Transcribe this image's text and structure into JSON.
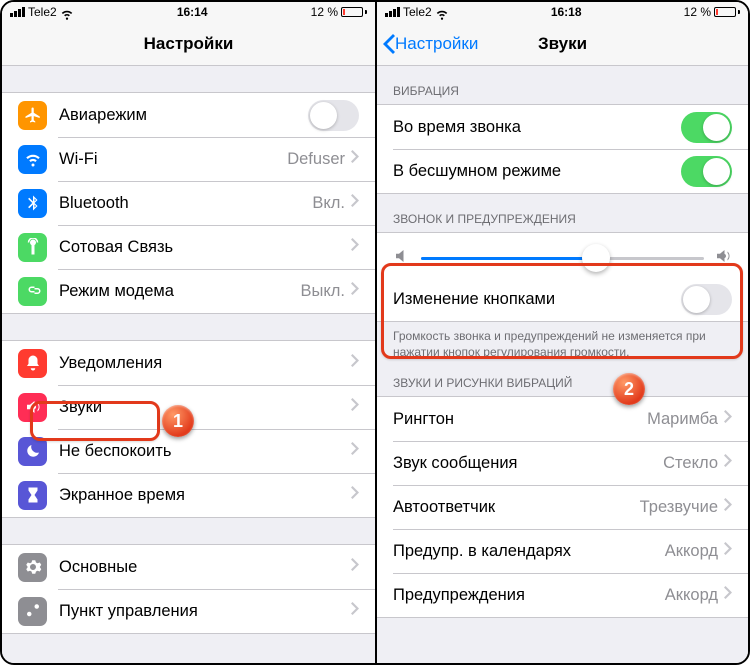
{
  "left": {
    "status": {
      "carrier": "Tele2",
      "time": "16:14",
      "battery": "12 %"
    },
    "nav": {
      "title": "Настройки"
    },
    "g1": [
      {
        "label": "Авиарежим",
        "icon": "airplane",
        "color": "#ff9500",
        "toggle": false
      },
      {
        "label": "Wi-Fi",
        "icon": "wifi",
        "color": "#007aff",
        "detail": "Defuser"
      },
      {
        "label": "Bluetooth",
        "icon": "bluetooth",
        "color": "#007aff",
        "detail": "Вкл."
      },
      {
        "label": "Сотовая Связь",
        "icon": "antenna",
        "color": "#4cd964"
      },
      {
        "label": "Режим модема",
        "icon": "link",
        "color": "#4cd964",
        "detail": "Выкл."
      }
    ],
    "g2": [
      {
        "label": "Уведомления",
        "icon": "bell",
        "color": "#ff3b30"
      },
      {
        "label": "Звуки",
        "icon": "speaker",
        "color": "#ff2d55"
      },
      {
        "label": "Не беспокоить",
        "icon": "moon",
        "color": "#5856d6"
      },
      {
        "label": "Экранное время",
        "icon": "hourglass",
        "color": "#5856d6"
      }
    ],
    "g3": [
      {
        "label": "Основные",
        "icon": "gear",
        "color": "#8e8e93"
      },
      {
        "label": "Пункт управления",
        "icon": "switches",
        "color": "#8e8e93"
      }
    ]
  },
  "right": {
    "status": {
      "carrier": "Tele2",
      "time": "16:18",
      "battery": "12 %"
    },
    "nav": {
      "back": "Настройки",
      "title": "Звуки"
    },
    "sec1": {
      "header": "ВИБРАЦИЯ",
      "rows": [
        {
          "label": "Во время звонка",
          "toggle": true
        },
        {
          "label": "В бесшумном режиме",
          "toggle": true
        }
      ]
    },
    "sec2": {
      "header": "ЗВОНОК И ПРЕДУПРЕЖДЕНИЯ",
      "slider": 62,
      "change": {
        "label": "Изменение кнопками",
        "toggle": false
      },
      "footer": "Громкость звонка и предупреждений не изменяется при нажатии кнопок регулирования громкости."
    },
    "sec3": {
      "header": "ЗВУКИ И РИСУНКИ ВИБРАЦИЙ",
      "rows": [
        {
          "label": "Рингтон",
          "detail": "Маримба"
        },
        {
          "label": "Звук сообщения",
          "detail": "Стекло"
        },
        {
          "label": "Автоответчик",
          "detail": "Трезвучие"
        },
        {
          "label": "Предупр. в календарях",
          "detail": "Аккорд"
        },
        {
          "label": "Предупреждения",
          "detail": "Аккорд"
        }
      ]
    }
  },
  "badges": {
    "one": "1",
    "two": "2"
  }
}
